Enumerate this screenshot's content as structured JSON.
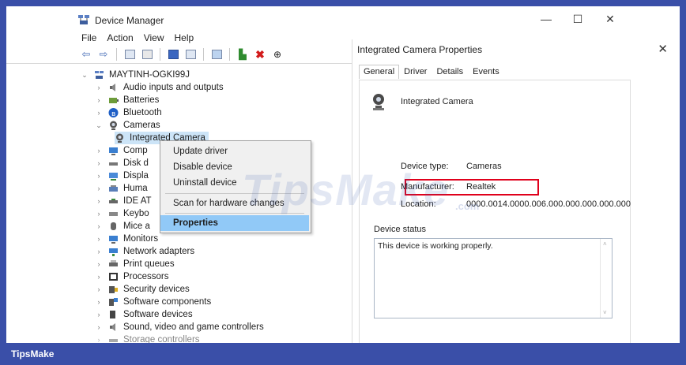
{
  "device_manager": {
    "title": "Device Manager",
    "window_controls": {
      "minimize": "—",
      "maximize": "☐",
      "close": "✕"
    },
    "menu": [
      "File",
      "Action",
      "View",
      "Help"
    ],
    "tree": {
      "root": "MAYTINH-OGKI99J",
      "items": [
        {
          "label": "Audio inputs and outputs",
          "icon": "speaker-icon"
        },
        {
          "label": "Batteries",
          "icon": "battery-icon"
        },
        {
          "label": "Bluetooth",
          "icon": "bluetooth-icon"
        },
        {
          "label": "Cameras",
          "icon": "camera-icon",
          "expanded": true
        },
        {
          "label": "Integrated Camera",
          "icon": "webcam-icon",
          "child": true,
          "selected": true
        },
        {
          "label": "Comp",
          "icon": "computer-icon"
        },
        {
          "label": "Disk d",
          "icon": "disk-icon"
        },
        {
          "label": "Displa",
          "icon": "display-icon"
        },
        {
          "label": "Huma",
          "icon": "hid-icon"
        },
        {
          "label": "IDE AT",
          "icon": "ide-icon"
        },
        {
          "label": "Keybo",
          "icon": "keyboard-icon"
        },
        {
          "label": "Mice a",
          "icon": "mouse-icon"
        },
        {
          "label": "Monitors",
          "icon": "monitor-icon"
        },
        {
          "label": "Network adapters",
          "icon": "network-icon"
        },
        {
          "label": "Print queues",
          "icon": "printer-icon"
        },
        {
          "label": "Processors",
          "icon": "processor-icon"
        },
        {
          "label": "Security devices",
          "icon": "security-icon"
        },
        {
          "label": "Software components",
          "icon": "software-component-icon"
        },
        {
          "label": "Software devices",
          "icon": "software-device-icon"
        },
        {
          "label": "Sound, video and game controllers",
          "icon": "sound-icon"
        },
        {
          "label": "Storage controllers",
          "icon": "storage-icon"
        }
      ]
    }
  },
  "context_menu": {
    "items": [
      "Update driver",
      "Disable device",
      "Uninstall device",
      "Scan for hardware changes",
      "Properties"
    ]
  },
  "properties_dialog": {
    "title": "Integrated Camera Properties",
    "close": "✕",
    "tabs": [
      "General",
      "Driver",
      "Details",
      "Events"
    ],
    "device_name": "Integrated Camera",
    "fields": {
      "device_type_label": "Device type:",
      "device_type_value": "Cameras",
      "manufacturer_label": "Manufacturer:",
      "manufacturer_value": "Realtek",
      "location_label": "Location:",
      "location_value": "0000.0014.0000.006.000.000.000.000.000"
    },
    "device_status_label": "Device status",
    "device_status_text": "This device is working properly."
  },
  "watermark": {
    "main": "TipsMake",
    "suffix": ".com"
  },
  "footer": {
    "brand": "TipsMake"
  },
  "colors": {
    "frame": "#3a4fa8",
    "highlight": "#91c9f7",
    "selection": "#cce4f7",
    "annotation_red": "#e0001b"
  }
}
